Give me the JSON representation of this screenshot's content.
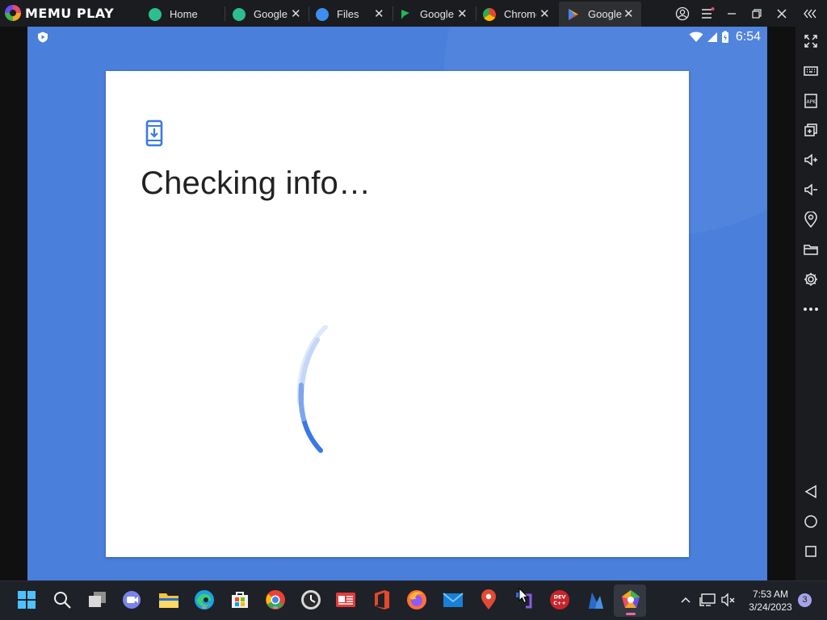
{
  "app": {
    "name": "MEMU PLAY"
  },
  "tabs": [
    {
      "label": "Home",
      "icon": "memu-home-icon",
      "color": "#2bbf8e"
    },
    {
      "label": "Google",
      "icon": "memu-home-icon",
      "color": "#2bbf8e"
    },
    {
      "label": "Files",
      "icon": "files-icon",
      "color": "#3d8ef0"
    },
    {
      "label": "Google",
      "icon": "google-play-games-icon",
      "color": "#1db954"
    },
    {
      "label": "Chrome",
      "icon": "chrome-icon",
      "color": "#e94335"
    },
    {
      "label": "Google",
      "icon": "google-play-icon",
      "color": "#34a853",
      "active": true
    }
  ],
  "status_bar": {
    "time": "6:54"
  },
  "dialog": {
    "title": "Checking info…",
    "icon": "phone-download-icon"
  },
  "colors": {
    "android_bg": "#4a7fdb",
    "accent": "#3b78e7",
    "topbar": "#1b1c1f",
    "taskbar": "#1e2127"
  },
  "sidebar": [
    "fullscreen-icon",
    "keyboard-icon",
    "apk-icon",
    "multi-instance-icon",
    "volume-up-icon",
    "volume-down-icon",
    "location-icon",
    "folder-icon",
    "settings-icon",
    "more-icon",
    "back-icon",
    "home-icon",
    "recents-icon"
  ],
  "taskbar": {
    "apps": [
      "windows-start-icon",
      "search-icon",
      "task-view-icon",
      "teams-chat-icon",
      "file-explorer-icon",
      "edge-icon",
      "microsoft-store-icon",
      "chrome-icon",
      "clock-app-icon",
      "news-icon",
      "office-icon",
      "firefox-icon",
      "mail-icon",
      "maps-icon",
      "power-automate-icon",
      "devcpp-icon",
      "bluestacks-icon",
      "memu-icon"
    ],
    "devcpp_label": "DEV C++",
    "clock_time": "7:53 AM",
    "clock_date": "3/24/2023",
    "notification_count": "3"
  }
}
